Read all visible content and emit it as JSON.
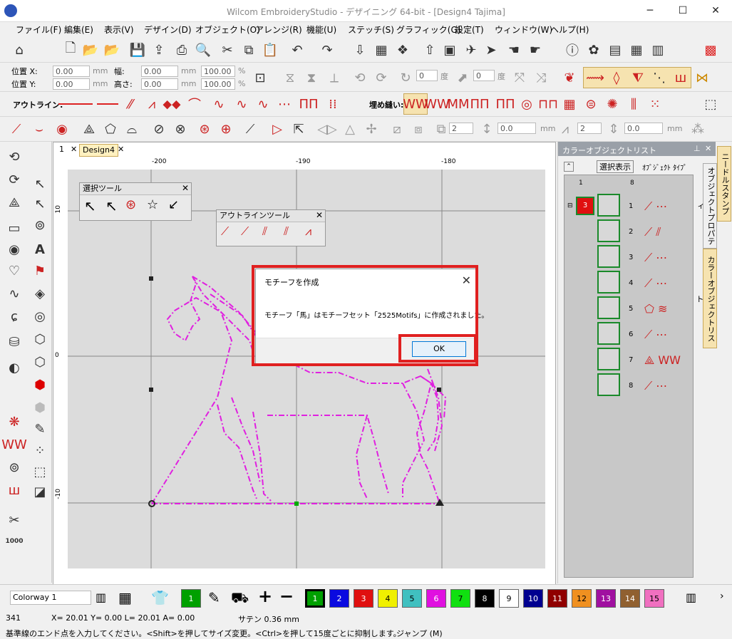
{
  "window": {
    "title": "Wilcom EmbroideryStudio - デザイニング 64-bit - [Design4     Tajima]",
    "minimize": "─",
    "maximize": "☐",
    "close": "✕"
  },
  "menu": [
    "ファイル(F)",
    "編集(E)",
    "表示(V)",
    "デザイン(D)",
    "オブジェクト(O)",
    "アレンジ(R)",
    "機能(U)",
    "ステッチ(S)",
    "グラフィック(G)",
    "設定(T)",
    "ウィンドウ(W)",
    "ヘルプ(H)"
  ],
  "properties": {
    "pos_x_label": "位置 X:",
    "pos_y_label": "位置 Y:",
    "pos_x": "0.00",
    "pos_y": "0.00",
    "unit": "mm",
    "width_label": "幅:",
    "height_label": "高さ:",
    "width": "0.00",
    "height": "0.00",
    "scale_w": "100.00",
    "scale_h": "100.00",
    "percent": "%",
    "angle1": "0",
    "angle2": "0",
    "degree": "度"
  },
  "outline_toolbar": {
    "label": "アウトライン:",
    "fill_label": "埋め縫い:"
  },
  "stitch_fields": {
    "f1": "2",
    "f2": "0.0",
    "f3": "2",
    "f4": "0.0",
    "unit": "mm"
  },
  "document": {
    "tabs": [
      "1",
      "Design4"
    ],
    "ruler_h": [
      "-200",
      "-190",
      "-180"
    ],
    "ruler_v": [
      "10",
      "0",
      "-10"
    ]
  },
  "select_tool_panel": {
    "title": "選択ツール"
  },
  "outline_tool_panel": {
    "title": "アウトラインツール"
  },
  "dialog": {
    "title": "モチーフを作成",
    "message": "モチーフ「馬」はモチーフセット「2525Motifs」に作成されました。",
    "ok": "OK"
  },
  "color_object_list": {
    "title": "カラーオブジェクトリスト",
    "toggle": "選択表示",
    "object_type": "ｵﾌﾞｼﾞｪｸﾄ ﾀｲﾌﾟ",
    "header_col1": "1",
    "header_col2": "8",
    "color_number": "3",
    "rows": [
      "1",
      "2",
      "3",
      "4",
      "5",
      "6",
      "7",
      "8"
    ]
  },
  "side_tabs": [
    "ニードルスタンプ",
    "オブジェクトプロパティ",
    "カラーオブジェクトリスト"
  ],
  "bottom": {
    "colorway": "Colorway 1",
    "current_color": "1",
    "swatches": [
      {
        "n": "1",
        "c": "#00a000",
        "fg": "#fff"
      },
      {
        "n": "2",
        "c": "#0a0ae0",
        "fg": "#fff"
      },
      {
        "n": "3",
        "c": "#e01010",
        "fg": "#fff"
      },
      {
        "n": "4",
        "c": "#f0f000",
        "fg": "#000"
      },
      {
        "n": "5",
        "c": "#40c0c0",
        "fg": "#000"
      },
      {
        "n": "6",
        "c": "#e010e0",
        "fg": "#fff"
      },
      {
        "n": "7",
        "c": "#10e010",
        "fg": "#000"
      },
      {
        "n": "8",
        "c": "#000000",
        "fg": "#fff"
      },
      {
        "n": "9",
        "c": "#ffffff",
        "fg": "#000"
      },
      {
        "n": "10",
        "c": "#000090",
        "fg": "#fff"
      },
      {
        "n": "11",
        "c": "#900000",
        "fg": "#fff"
      },
      {
        "n": "12",
        "c": "#f09020",
        "fg": "#000"
      },
      {
        "n": "13",
        "c": "#a010a0",
        "fg": "#fff"
      },
      {
        "n": "14",
        "c": "#906030",
        "fg": "#fff"
      },
      {
        "n": "15",
        "c": "#f070c0",
        "fg": "#000"
      }
    ]
  },
  "status": {
    "count": "341",
    "coords": "X=  20.01 Y=   0.00 L=  20.01 A=   0.00",
    "stitch": "サテン  0.36 mm",
    "hint": "基準線のエンド点を入力してください。<Shift>を押してサイズ変更。<Ctrl>を押して15度ごとに抑制します。",
    "jump": "ジャンプ (M)"
  },
  "colors": {
    "accent_red": "#e02020",
    "outline_magenta": "#e020e0",
    "object_green": "#1a8a2a"
  }
}
